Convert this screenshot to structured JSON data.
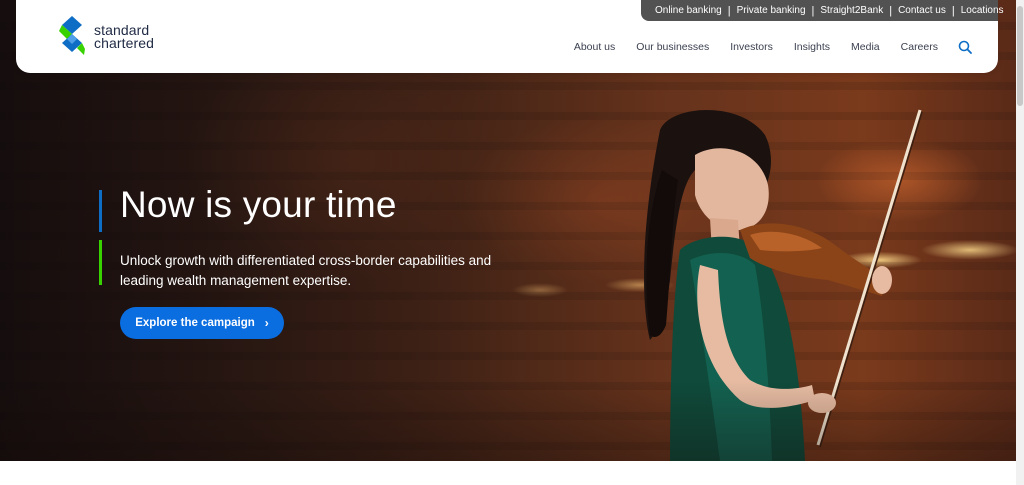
{
  "brand": {
    "name_line1": "standard",
    "name_line2": "chartered",
    "colors": {
      "green": "#38d200",
      "blue": "#0e6ec5",
      "navy": "#1f2a44"
    }
  },
  "utility_nav": {
    "items": [
      {
        "label": "Online banking"
      },
      {
        "label": "Private banking"
      },
      {
        "label": "Straight2Bank"
      },
      {
        "label": "Contact us"
      },
      {
        "label": "Locations"
      }
    ]
  },
  "main_nav": {
    "items": [
      {
        "label": "About us"
      },
      {
        "label": "Our businesses"
      },
      {
        "label": "Investors"
      },
      {
        "label": "Insights"
      },
      {
        "label": "Media"
      },
      {
        "label": "Careers"
      }
    ],
    "search_icon": "search-icon"
  },
  "hero": {
    "title": "Now is your time",
    "subtitle": "Unlock growth with differentiated cross-border capabilities and leading wealth management expertise.",
    "cta_label": "Explore the campaign",
    "cta_icon": "chevron-right-icon",
    "cta_color": "#0a6de0"
  }
}
